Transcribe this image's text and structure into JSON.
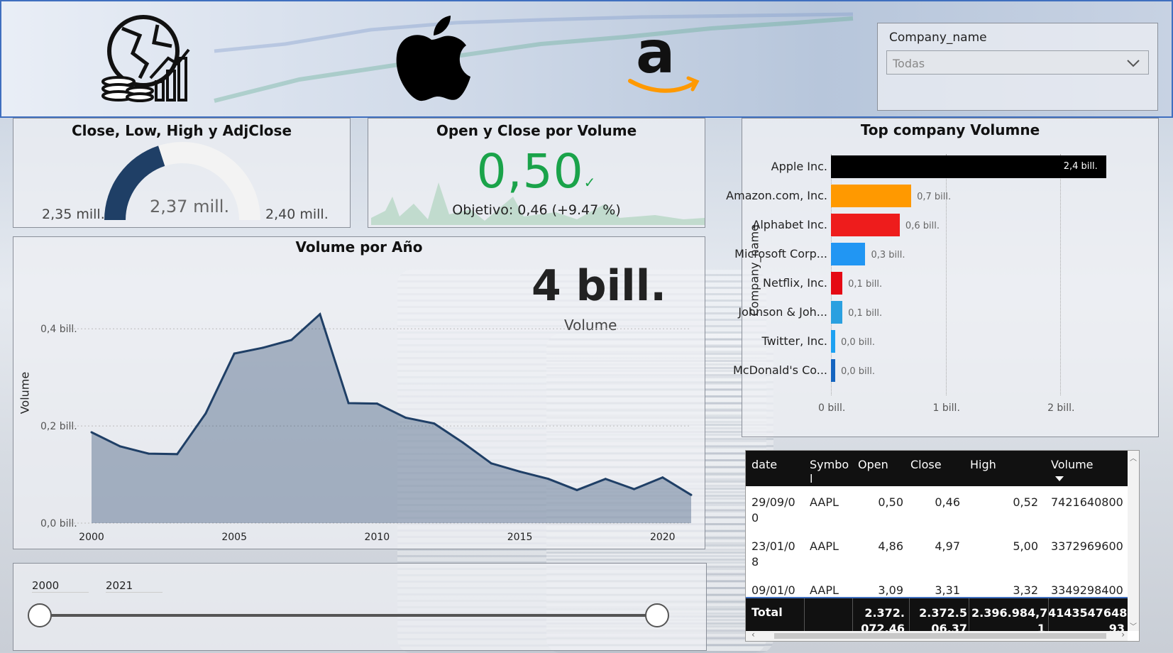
{
  "header": {
    "icons": [
      "globe-finance-icon",
      "apple-logo-icon",
      "amazon-logo-icon"
    ]
  },
  "slicer": {
    "label": "Company_name",
    "selected": "Todas"
  },
  "gauge": {
    "title": "Close, Low, High y AdjClose",
    "min_label": "2,35 mill.",
    "value_label": "2,37 mill.",
    "max_label": "2,40 mill.",
    "fill_fraction": 0.4,
    "color": "#1f3f66"
  },
  "kpi": {
    "title": "Open y Close por Volume",
    "value": "0,50",
    "check": "✓",
    "goal": "Objetivo: 0,46 (+9.47 %)",
    "color": "#1aa34a"
  },
  "volume_chart": {
    "title": "Volume por Año",
    "card_value": "4 bill.",
    "card_label": "Volume",
    "ylabel": "Volume",
    "yticks": [
      "0,4 bill.",
      "0,2 bill.",
      "0,0 bill."
    ],
    "xticks": [
      "2000",
      "2005",
      "2010",
      "2015",
      "2020"
    ]
  },
  "chart_data": [
    {
      "type": "area",
      "title": "Volume por Año",
      "xlabel": "",
      "ylabel": "Volume",
      "x": [
        2000,
        2001,
        2002,
        2003,
        2004,
        2005,
        2006,
        2007,
        2008,
        2009,
        2010,
        2011,
        2012,
        2013,
        2014,
        2015,
        2016,
        2017,
        2018,
        2019,
        2020,
        2021
      ],
      "values": [
        0.187,
        0.158,
        0.143,
        0.142,
        0.226,
        0.349,
        0.361,
        0.377,
        0.43,
        0.247,
        0.246,
        0.217,
        0.205,
        0.166,
        0.123,
        0.106,
        0.091,
        0.068,
        0.091,
        0.07,
        0.094,
        0.058
      ],
      "ylim": [
        0,
        0.45
      ],
      "unit": "bill.",
      "color": "#1f3f66"
    },
    {
      "type": "bar",
      "title": "Top company Volumne",
      "ylabel": "Company_name",
      "categories": [
        "Apple Inc.",
        "Amazon.com, Inc.",
        "Alphabet Inc.",
        "Microsoft Corp...",
        "Netflix, Inc.",
        "Johnson & Joh...",
        "Twitter, Inc.",
        "McDonald's Co..."
      ],
      "values": [
        2.4,
        0.7,
        0.6,
        0.3,
        0.1,
        0.1,
        0.0,
        0.0
      ],
      "value_labels": [
        "2,4 bill.",
        "0,7 bill.",
        "0,6 bill.",
        "0,3 bill.",
        "0,1 bill.",
        "0,1 bill.",
        "0,0 bill.",
        "0,0 bill."
      ],
      "colors": [
        "#000000",
        "#ff9900",
        "#ee1c1c",
        "#2196f3",
        "#e50914",
        "#2aa0e0",
        "#1da1f2",
        "#1565c0"
      ],
      "xticks": [
        "0 bill.",
        "1 bill.",
        "2 bill."
      ],
      "xlim": [
        0,
        2.6
      ]
    }
  ],
  "range_slider": {
    "start": "2000",
    "end": "2021"
  },
  "table": {
    "columns": [
      "date",
      "Symbo\nl",
      "Open",
      "Close",
      "High",
      "Volume"
    ],
    "rows": [
      [
        "29/09/0\n0",
        "AAPL",
        "0,50",
        "0,46",
        "0,52",
        "7421640800"
      ],
      [
        "23/01/0\n8",
        "AAPL",
        "4,86",
        "4,97",
        "5,00",
        "3372969600"
      ],
      [
        "09/01/0",
        "AAPL",
        "3,09",
        "3,31",
        "3,32",
        "3349298400"
      ]
    ],
    "total": {
      "label": "Total",
      "open": "2.372.\n072,46",
      "close": "2.372.5\n06,37",
      "high": "2.396.984,7\n1",
      "volume": "41435476483\n93"
    }
  }
}
